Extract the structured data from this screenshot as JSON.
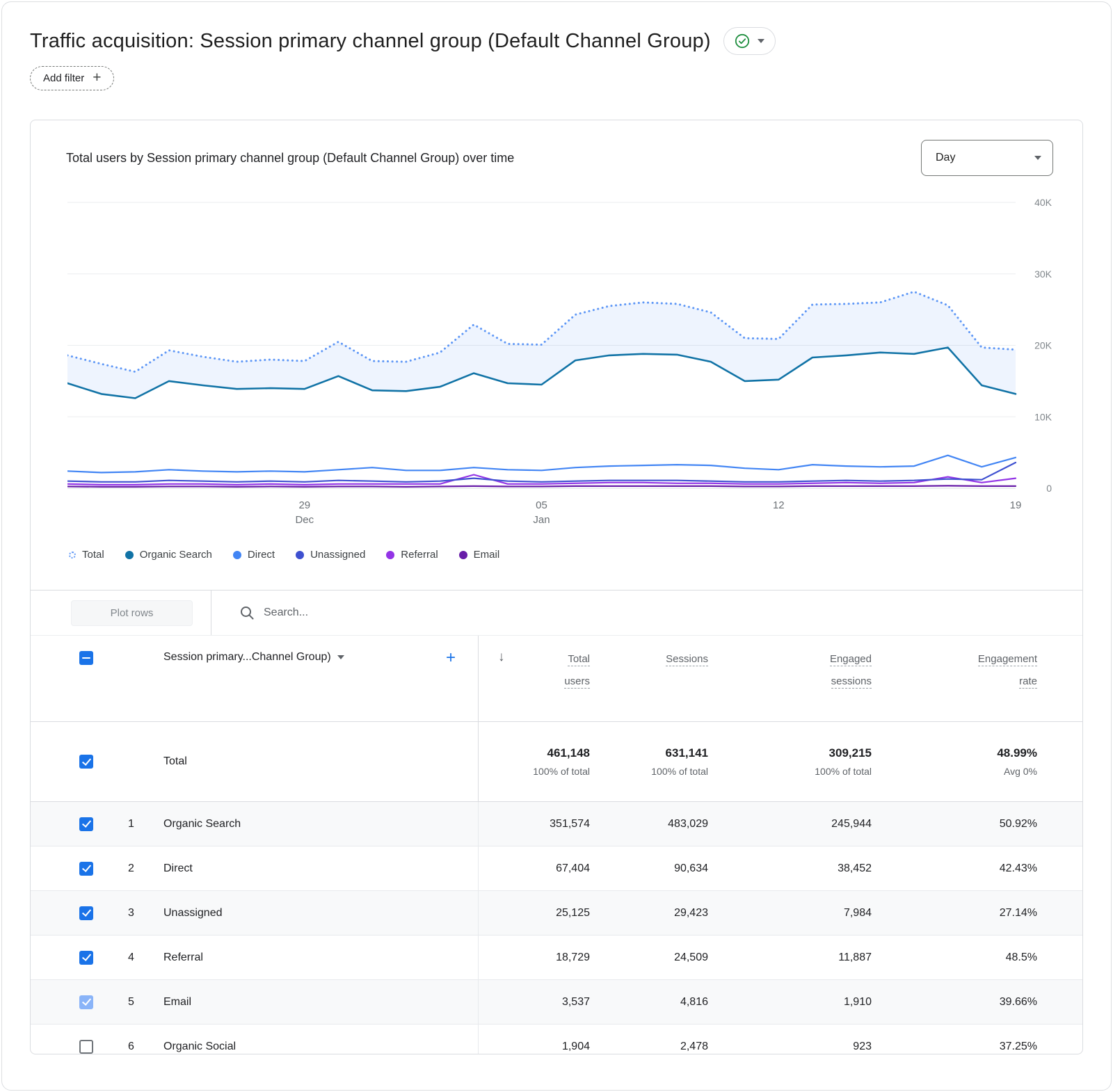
{
  "page": {
    "title": "Traffic acquisition: Session primary channel group (Default Channel Group)",
    "add_filter_label": "Add filter"
  },
  "chart_card": {
    "title": "Total users by Session primary channel group (Default Channel Group) over time",
    "granularity": "Day"
  },
  "chart_data": {
    "type": "line",
    "title": "Total users by Session primary channel group (Default Channel Group) over time",
    "values_unit": "total users (thousands)",
    "ylim": [
      0,
      40000
    ],
    "y_ticks": [
      "40K",
      "30K",
      "20K",
      "10K",
      "0"
    ],
    "y_axis_side": "right",
    "legend_position": "bottom",
    "grid": true,
    "x": [
      "Dec 22",
      "Dec 23",
      "Dec 24",
      "Dec 25",
      "Dec 26",
      "Dec 27",
      "Dec 28",
      "Dec 29",
      "Dec 30",
      "Dec 31",
      "Jan 1",
      "Jan 2",
      "Jan 3",
      "Jan 4",
      "Jan 5",
      "Jan 6",
      "Jan 7",
      "Jan 8",
      "Jan 9",
      "Jan 10",
      "Jan 11",
      "Jan 12",
      "Jan 13",
      "Jan 14",
      "Jan 15",
      "Jan 16",
      "Jan 17",
      "Jan 18",
      "Jan 19"
    ],
    "x_ticks": [
      {
        "index": 7,
        "line1": "29",
        "line2": "Dec"
      },
      {
        "index": 14,
        "line1": "05",
        "line2": "Jan"
      },
      {
        "index": 21,
        "line1": "12"
      },
      {
        "index": 28,
        "line1": "19"
      }
    ],
    "series": [
      {
        "name": "Total",
        "color": "#5E97F6",
        "style": "dotted",
        "values": [
          18.6,
          17.4,
          16.3,
          19.3,
          18.4,
          17.7,
          18.0,
          17.8,
          20.5,
          17.8,
          17.7,
          19.0,
          22.9,
          20.2,
          20.1,
          24.3,
          25.5,
          26.0,
          25.8,
          24.6,
          21.0,
          20.9,
          25.7,
          25.8,
          26.0,
          27.5,
          25.6,
          19.7,
          19.4
        ]
      },
      {
        "name": "Organic Search",
        "color": "#1173A6",
        "style": "solid",
        "values": [
          14.7,
          13.2,
          12.6,
          15.0,
          14.4,
          13.9,
          14.0,
          13.9,
          15.7,
          13.7,
          13.6,
          14.2,
          16.1,
          14.7,
          14.5,
          17.9,
          18.6,
          18.8,
          18.7,
          17.7,
          15.0,
          15.2,
          18.3,
          18.6,
          19.0,
          18.8,
          19.7,
          14.4,
          13.2
        ]
      },
      {
        "name": "Direct",
        "color": "#4285F4",
        "style": "solid",
        "values": [
          2.4,
          2.2,
          2.3,
          2.6,
          2.4,
          2.3,
          2.4,
          2.3,
          2.6,
          2.9,
          2.5,
          2.5,
          2.9,
          2.6,
          2.5,
          2.9,
          3.1,
          3.2,
          3.3,
          3.2,
          2.8,
          2.6,
          3.3,
          3.1,
          3.0,
          3.1,
          4.6,
          3.0,
          4.3
        ]
      },
      {
        "name": "Unassigned",
        "color": "#3E50D0",
        "style": "solid",
        "values": [
          1.0,
          0.9,
          0.9,
          1.1,
          1.0,
          0.9,
          1.0,
          0.9,
          1.1,
          1.0,
          0.9,
          1.0,
          1.4,
          1.0,
          0.9,
          1.0,
          1.1,
          1.1,
          1.1,
          1.0,
          0.9,
          0.9,
          1.0,
          1.1,
          1.0,
          1.1,
          1.3,
          1.2,
          3.6
        ]
      },
      {
        "name": "Referral",
        "color": "#9334E6",
        "style": "solid",
        "values": [
          0.6,
          0.5,
          0.5,
          0.6,
          0.6,
          0.5,
          0.6,
          0.5,
          0.6,
          0.6,
          0.6,
          0.6,
          1.9,
          0.6,
          0.6,
          0.7,
          0.8,
          0.8,
          0.7,
          0.7,
          0.6,
          0.6,
          0.7,
          0.8,
          0.7,
          0.8,
          1.6,
          0.8,
          1.4
        ]
      },
      {
        "name": "Email",
        "color": "#681DA8",
        "style": "solid",
        "values": [
          0.25,
          0.2,
          0.2,
          0.25,
          0.25,
          0.2,
          0.25,
          0.2,
          0.25,
          0.25,
          0.2,
          0.25,
          0.3,
          0.25,
          0.25,
          0.3,
          0.3,
          0.3,
          0.3,
          0.3,
          0.25,
          0.25,
          0.3,
          0.3,
          0.3,
          0.3,
          0.35,
          0.3,
          0.3
        ]
      }
    ],
    "band_fill_between": [
      "Total",
      "Organic Search"
    ],
    "band_fill_color": "rgba(66,133,244,0.09)"
  },
  "table": {
    "plot_rows_label": "Plot rows",
    "search_placeholder": "Search...",
    "dimension_header": "Session primary...Channel Group)",
    "columns": [
      {
        "lines": [
          "Total",
          "users"
        ]
      },
      {
        "lines": [
          "Sessions"
        ]
      },
      {
        "lines": [
          "Engaged",
          "sessions"
        ]
      },
      {
        "lines": [
          "Engagement",
          "rate"
        ]
      }
    ],
    "total_row": {
      "label": "Total",
      "values": [
        "461,148",
        "631,141",
        "309,215",
        "48.99%"
      ],
      "subvalues": [
        "100% of total",
        "100% of total",
        "100% of total",
        "Avg 0%"
      ]
    },
    "rows": [
      {
        "index": "1",
        "name": "Organic Search",
        "values": [
          "351,574",
          "483,029",
          "245,944",
          "50.92%"
        ],
        "checkbox": "checked"
      },
      {
        "index": "2",
        "name": "Direct",
        "values": [
          "67,404",
          "90,634",
          "38,452",
          "42.43%"
        ],
        "checkbox": "checked"
      },
      {
        "index": "3",
        "name": "Unassigned",
        "values": [
          "25,125",
          "29,423",
          "7,984",
          "27.14%"
        ],
        "checkbox": "checked"
      },
      {
        "index": "4",
        "name": "Referral",
        "values": [
          "18,729",
          "24,509",
          "11,887",
          "48.5%"
        ],
        "checkbox": "checked"
      },
      {
        "index": "5",
        "name": "Email",
        "values": [
          "3,537",
          "4,816",
          "1,910",
          "39.66%"
        ],
        "checkbox": "checked-light"
      },
      {
        "index": "6",
        "name": "Organic Social",
        "values": [
          "1,904",
          "2,478",
          "923",
          "37.25%"
        ],
        "checkbox": "unchecked"
      }
    ]
  },
  "icons": {
    "plus": "+",
    "sort_descending": "↓",
    "status_check": "check-circle"
  },
  "colors": {
    "accent_blue": "#1A73E8",
    "status_green": "#1E8E3E",
    "text_primary": "#202124",
    "text_secondary": "#5F6368",
    "border": "#DADCE0"
  }
}
